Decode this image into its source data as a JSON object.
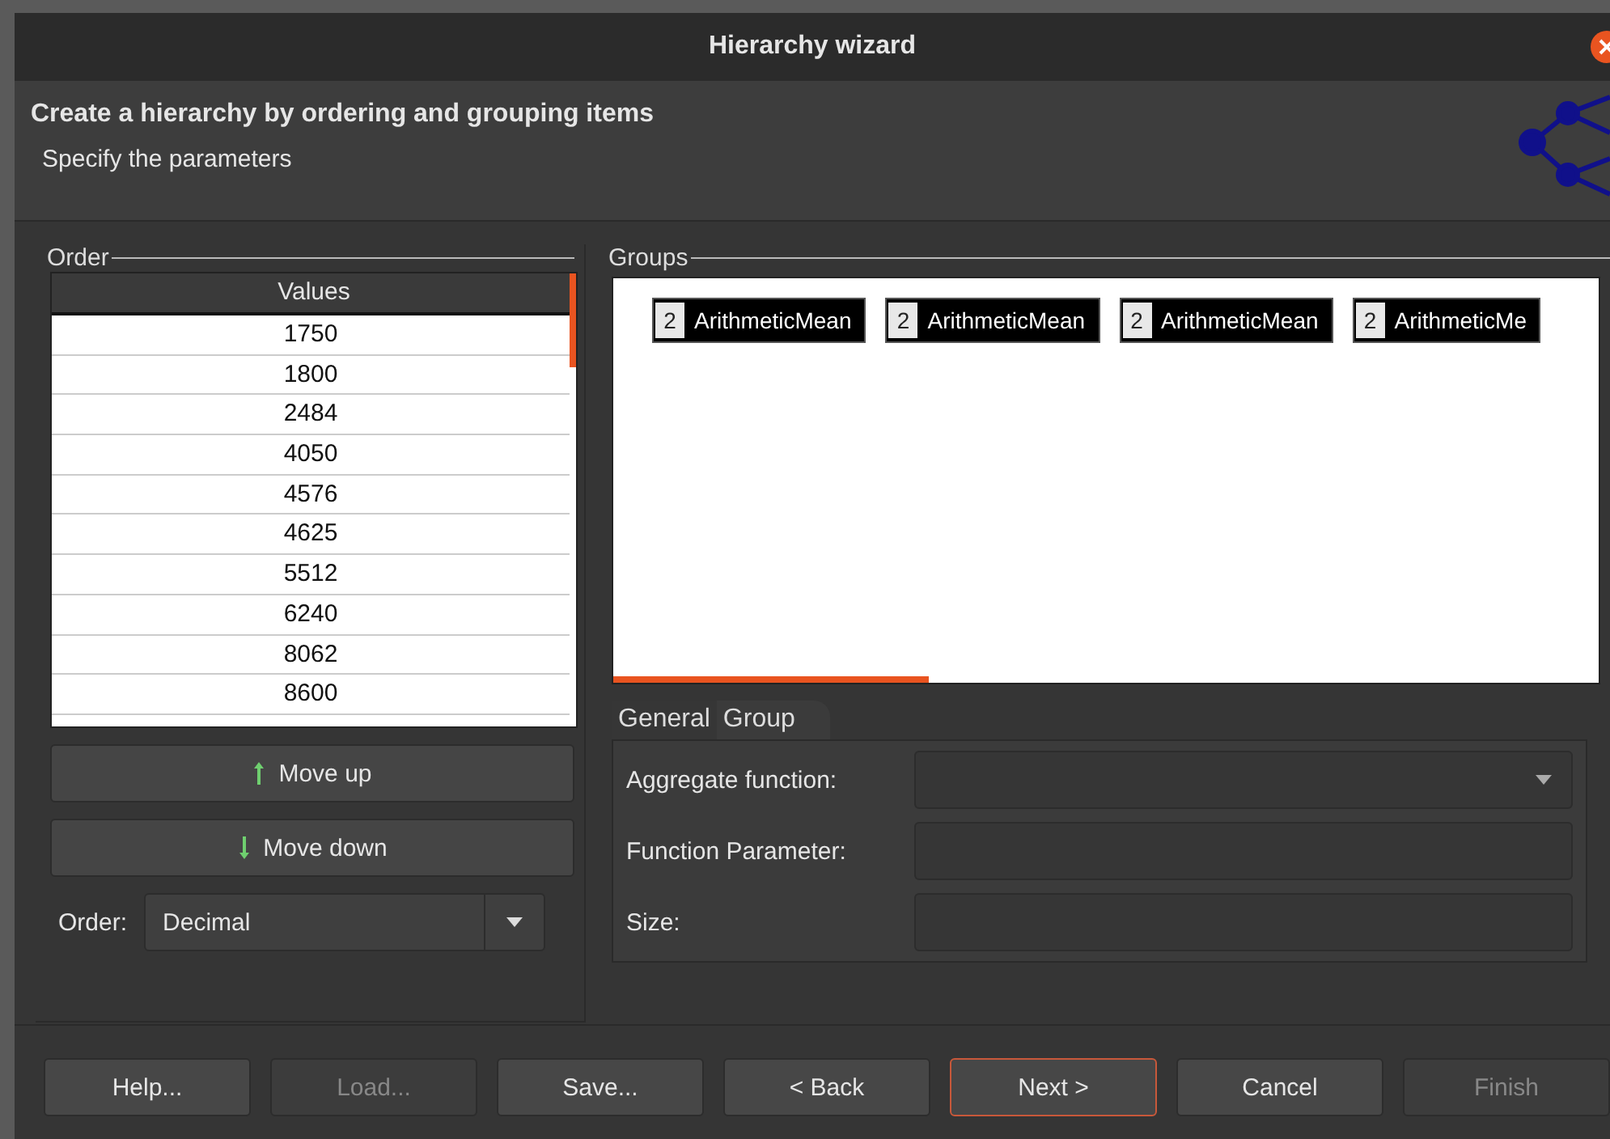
{
  "window": {
    "title": "Hierarchy wizard"
  },
  "header": {
    "title": "Create a hierarchy by ordering and grouping items",
    "subtitle": "Specify the parameters"
  },
  "order": {
    "legend": "Order",
    "column": "Values",
    "rows": [
      "1750",
      "1800",
      "2484",
      "4050",
      "4576",
      "4625",
      "5512",
      "6240",
      "8062",
      "8600"
    ],
    "buttons": [
      {
        "label": "Move up",
        "kind": "up"
      },
      {
        "label": "Move down",
        "kind": "down"
      }
    ],
    "order_label": "Order:",
    "order_value": "Decimal"
  },
  "groups": {
    "legend": "Groups",
    "items": [
      {
        "count": "2",
        "label": "ArithmeticMean"
      },
      {
        "count": "2",
        "label": "ArithmeticMean"
      },
      {
        "count": "2",
        "label": "ArithmeticMean"
      },
      {
        "count": "2",
        "label": "ArithmeticMe"
      }
    ],
    "tabs": [
      {
        "label": "General",
        "selected": false
      },
      {
        "label": "Group",
        "selected": true
      }
    ],
    "fields": [
      {
        "label": "Aggregate function:",
        "kind": "dropdown"
      },
      {
        "label": "Function Parameter:",
        "kind": "text"
      },
      {
        "label": "Size:",
        "kind": "text"
      }
    ]
  },
  "buttons": [
    {
      "label": "Help...",
      "disabled": false,
      "default": false
    },
    {
      "label": "Load...",
      "disabled": true,
      "default": false
    },
    {
      "label": "Save...",
      "disabled": false,
      "default": false
    },
    {
      "label": "< Back",
      "disabled": false,
      "default": false
    },
    {
      "label": "Next >",
      "disabled": false,
      "default": true
    },
    {
      "label": "Cancel",
      "disabled": false,
      "default": false
    },
    {
      "label": "Finish",
      "disabled": true,
      "default": false
    }
  ]
}
